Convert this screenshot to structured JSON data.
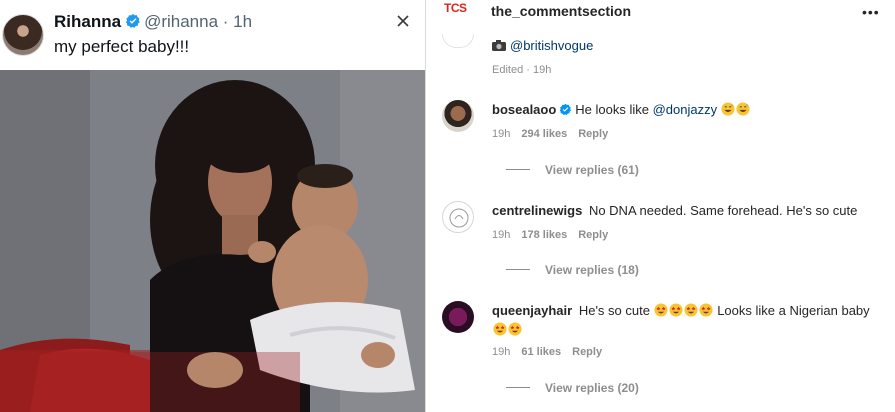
{
  "tweet": {
    "name": "Rihanna",
    "handle": "@rihanna",
    "separator": "·",
    "time": "1h",
    "text": "my perfect baby!!!"
  },
  "instagram": {
    "account": "the_commentsection",
    "logo_text": "TCS",
    "more_icon": "more-horizontal-icon",
    "caption": {
      "credit_tag": "@britishvogue",
      "edited_label": "Edited",
      "edited_time": "19h"
    },
    "comments": [
      {
        "user": "bosealaoo",
        "verified": true,
        "text_before": "He looks like ",
        "tag": "@donjazzy",
        "text_after": " ",
        "emojis_inline": [
          "grinning-sweat",
          "grinning-sweat"
        ],
        "time": "19h",
        "likes": "294 likes",
        "reply": "Reply",
        "view_replies": "View replies (61)"
      },
      {
        "user": "centrelinewigs",
        "verified": false,
        "text": "No DNA needed. Same forehead. He's so cute",
        "time": "19h",
        "likes": "178 likes",
        "reply": "Reply",
        "view_replies": "View replies (18)"
      },
      {
        "user": "queenjayhair",
        "verified": false,
        "text_before": "He's so cute ",
        "text_middle": " Looks like a Nigerian baby ",
        "emojis_first": [
          "star-struck",
          "star-struck",
          "star-struck",
          "star-struck"
        ],
        "emojis_last": [
          "star-struck",
          "star-struck"
        ],
        "time": "19h",
        "likes": "61 likes",
        "reply": "Reply",
        "view_replies": "View replies (20)"
      }
    ]
  },
  "colors": {
    "link": "#00376b",
    "muted": "#8e8e8e",
    "twitter_blue": "#1d9bf0",
    "ig_verified": "#0095f6",
    "tcs_red": "#d7261e"
  }
}
